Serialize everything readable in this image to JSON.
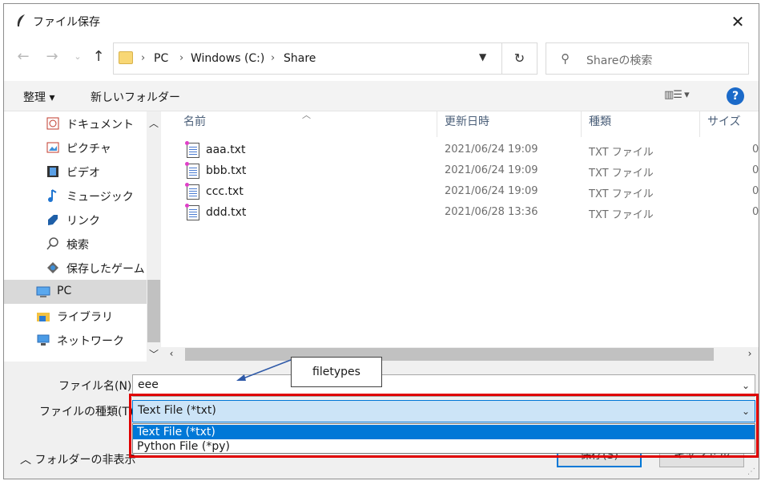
{
  "window": {
    "title": "ファイル保存"
  },
  "nav": {
    "crumbs": [
      "PC",
      "Windows (C:)",
      "Share"
    ],
    "search_placeholder": "Shareの検索"
  },
  "toolbar": {
    "organize": "整理 ▾",
    "new_folder": "新しいフォルダー"
  },
  "sidebar": {
    "items": [
      {
        "label": "ドキュメント",
        "icon": "documents-icon"
      },
      {
        "label": "ピクチャ",
        "icon": "pictures-icon"
      },
      {
        "label": "ビデオ",
        "icon": "videos-icon"
      },
      {
        "label": "ミュージック",
        "icon": "music-icon"
      },
      {
        "label": "リンク",
        "icon": "links-icon"
      },
      {
        "label": "検索",
        "icon": "search-icon"
      },
      {
        "label": "保存したゲーム",
        "icon": "saved-games-icon"
      },
      {
        "label": "PC",
        "icon": "pc-icon"
      },
      {
        "label": "ライブラリ",
        "icon": "library-icon"
      },
      {
        "label": "ネットワーク",
        "icon": "network-icon"
      }
    ]
  },
  "columns": {
    "name": "名前",
    "date": "更新日時",
    "type": "種類",
    "size": "サイズ"
  },
  "files": [
    {
      "name": "aaa.txt",
      "date": "2021/06/24 19:09",
      "type": "TXT ファイル",
      "size": "0"
    },
    {
      "name": "bbb.txt",
      "date": "2021/06/24 19:09",
      "type": "TXT ファイル",
      "size": "0"
    },
    {
      "name": "ccc.txt",
      "date": "2021/06/24 19:09",
      "type": "TXT ファイル",
      "size": "0"
    },
    {
      "name": "ddd.txt",
      "date": "2021/06/28 13:36",
      "type": "TXT ファイル",
      "size": "0"
    }
  ],
  "form": {
    "filename_label": "ファイル名(N):",
    "filename_value": "eee",
    "filetype_label": "ファイルの種類(T):",
    "filetype_value": "Text File (*txt)",
    "filetype_options": [
      "Text File (*txt)",
      "Python File (*py)"
    ]
  },
  "buttons": {
    "save": "保存(S)",
    "cancel": "キャンセル",
    "hide_folders": "フォルダーの非表示"
  },
  "annotation": {
    "callout": "filetypes"
  },
  "colors": {
    "accent": "#0078d7",
    "highlight_frame": "#e00000",
    "help": "#1b6ac9"
  }
}
